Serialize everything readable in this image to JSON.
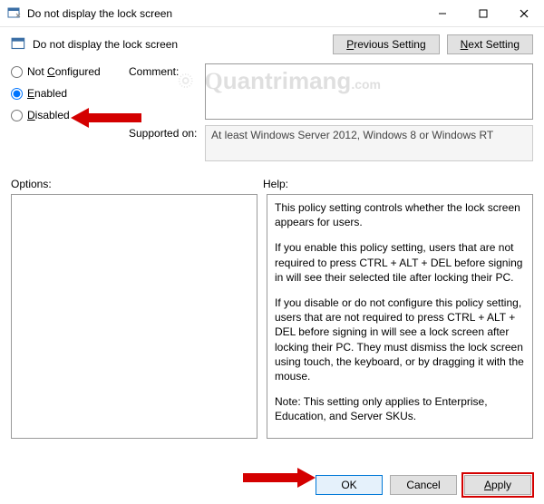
{
  "window": {
    "title": "Do not display the lock screen"
  },
  "header": {
    "title": "Do not display the lock screen",
    "prev_btn": "Previous Setting",
    "next_btn": "Next Setting"
  },
  "radios": {
    "not_configured": "Not Configured",
    "enabled": "Enabled",
    "disabled": "Disabled",
    "selected": "enabled"
  },
  "labels": {
    "comment": "Comment:",
    "supported": "Supported on:",
    "options": "Options:",
    "help": "Help:"
  },
  "comment_value": "",
  "supported_value": "At least Windows Server 2012, Windows 8 or Windows RT",
  "help_paragraphs": [
    "This policy setting controls whether the lock screen appears for users.",
    "If you enable this policy setting, users that are not required to press CTRL + ALT + DEL before signing in will see their selected tile after locking their PC.",
    "If you disable or do not configure this policy setting, users that are not required to press CTRL + ALT + DEL before signing in will see a lock screen after locking their PC. They must dismiss the lock screen using touch, the keyboard, or by dragging it with the mouse.",
    "Note: This setting only applies to Enterprise, Education, and Server SKUs."
  ],
  "footer": {
    "ok": "OK",
    "cancel": "Cancel",
    "apply": "Apply"
  },
  "watermark_text": "uantrimang"
}
